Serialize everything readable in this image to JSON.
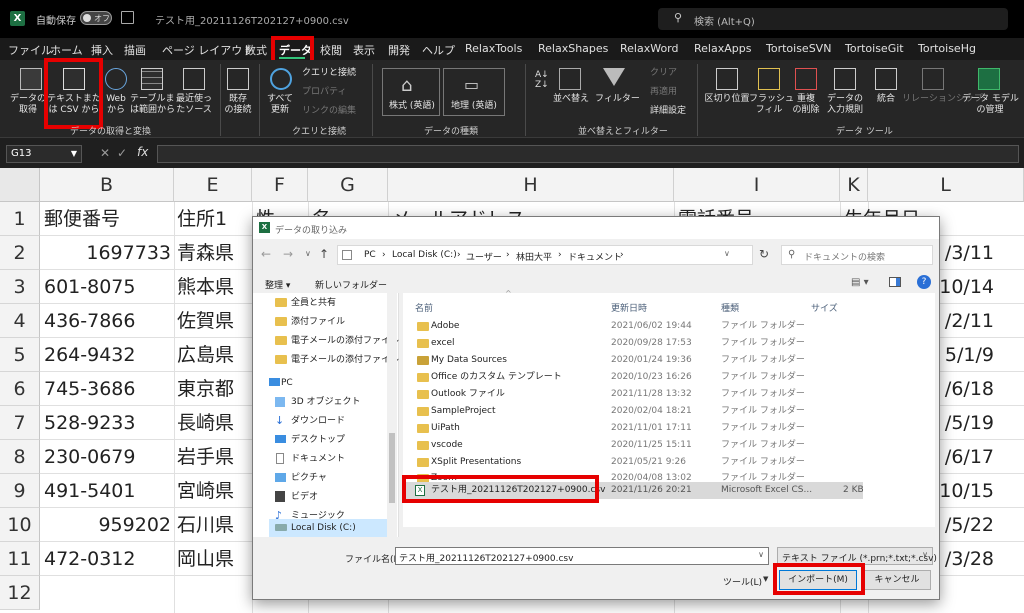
{
  "titlebar": {
    "autosave": "自動保存",
    "toggle": "オフ",
    "filename": "テスト用_20211126T202127+0900.csv",
    "search_placeholder": "検索 (Alt+Q)"
  },
  "menu": [
    "ファイル",
    "ホーム",
    "挿入",
    "描画",
    "ページ レイアウト",
    "数式",
    "データ",
    "校閲",
    "表示",
    "開発",
    "ヘルプ",
    "RelaxTools",
    "RelaxShapes",
    "RelaxWord",
    "RelaxApps",
    "TortoiseSVN",
    "TortoiseGit",
    "TortoiseHg"
  ],
  "ribbon": {
    "get_data": "データの\n取得",
    "from_csv": "テキストまた\nは CSV から",
    "from_web": "Web\nから",
    "from_table": "テーブルま\nは範囲から",
    "recent": "最近使っ\nたソース",
    "existing": "既存\nの接続",
    "refresh_all": "すべて\n更新",
    "queries": "クエリと接続",
    "properties": "プロパティ",
    "edit_links": "リンクの編集",
    "stocks": "株式 (英語)",
    "geo": "地理 (英語)",
    "sort": "並べ替え",
    "filter": "フィルター",
    "clear": "クリア",
    "reapply": "再適用",
    "advanced": "詳細設定",
    "text_to_col": "区切り位置",
    "flash_fill": "フラッシュ\nフィル",
    "remove_dup": "重複\nの削除",
    "validation": "データの\n入力規則",
    "consolidate": "統合",
    "relationships": "リレーションシップ",
    "data_model": "データ モデル\nの管理",
    "groups": [
      "データの取得と変換",
      "クエリと接続",
      "データの種類",
      "並べ替えとフィルター",
      "データ ツール"
    ]
  },
  "formula": {
    "namebox": "G13",
    "fx": "fx"
  },
  "sheet": {
    "columns": [
      "B",
      "E",
      "F",
      "G",
      "H",
      "I",
      "K",
      "L"
    ],
    "rows": [
      "1",
      "2",
      "3",
      "4",
      "5",
      "6",
      "7",
      "8",
      "9",
      "10",
      "11",
      "12"
    ],
    "colB": [
      "郵便番号",
      "1697733",
      "601-8075",
      "436-7866",
      "264-9432",
      "745-3686",
      "528-9233",
      "230-0679",
      "491-5401",
      "959202",
      "472-0312"
    ],
    "colE": [
      "住所1",
      "青森県",
      "熊本県",
      "佐賀県",
      "広島県",
      "東京都",
      "長崎県",
      "岩手県",
      "宮崎県",
      "石川県",
      "岡山県"
    ],
    "colF1": "性",
    "colG1": "名",
    "colH1": "メールアドレス",
    "colI1": "電話番号",
    "colK1": "生年月日",
    "colL": [
      "",
      "/3/11",
      "10/14",
      "/2/11",
      "5/1/9",
      "/6/18",
      "/5/19",
      "/6/17",
      "10/15",
      "/5/22",
      "/3/28"
    ]
  },
  "dialog": {
    "title": "データの取り込み",
    "path": [
      "PC",
      "Local Disk (C:)",
      "ユーザー",
      "林田大平",
      "ドキュメント"
    ],
    "search_placeholder": "ドキュメントの検索",
    "organize": "整理 ▾",
    "new_folder": "新しいフォルダー",
    "nav": [
      "全員と共有",
      "添付ファイル",
      "電子メールの添付ファイル",
      "電子メールの添付ファイル",
      "PC",
      "3D オブジェクト",
      "ダウンロード",
      "デスクトップ",
      "ドキュメント",
      "ピクチャ",
      "ビデオ",
      "ミュージック",
      "Local Disk (C:)"
    ],
    "headers": [
      "名前",
      "更新日時",
      "種類",
      "サイズ"
    ],
    "files": [
      {
        "name": "Adobe",
        "date": "2021/06/02 19:44",
        "type": "ファイル フォルダー",
        "size": ""
      },
      {
        "name": "excel",
        "date": "2020/09/28 17:53",
        "type": "ファイル フォルダー",
        "size": ""
      },
      {
        "name": "My Data Sources",
        "date": "2020/01/24 19:36",
        "type": "ファイル フォルダー",
        "size": ""
      },
      {
        "name": "Office のカスタム テンプレート",
        "date": "2020/10/23 16:26",
        "type": "ファイル フォルダー",
        "size": ""
      },
      {
        "name": "Outlook ファイル",
        "date": "2021/11/28 13:32",
        "type": "ファイル フォルダー",
        "size": ""
      },
      {
        "name": "SampleProject",
        "date": "2020/02/04 18:21",
        "type": "ファイル フォルダー",
        "size": ""
      },
      {
        "name": "UiPath",
        "date": "2021/11/01 17:11",
        "type": "ファイル フォルダー",
        "size": ""
      },
      {
        "name": "vscode",
        "date": "2020/11/25 15:11",
        "type": "ファイル フォルダー",
        "size": ""
      },
      {
        "name": "XSplit Presentations",
        "date": "2021/05/21 9:26",
        "type": "ファイル フォルダー",
        "size": ""
      },
      {
        "name": "Zoom",
        "date": "2020/04/08 13:02",
        "type": "ファイル フォルダー",
        "size": ""
      },
      {
        "name": "テスト用_20211126T202127+0900.csv",
        "date": "2021/11/26 20:21",
        "type": "Microsoft Excel CS...",
        "size": "2 KB"
      }
    ],
    "filename_label": "ファイル名(N):",
    "filename_value": "テスト用_20211126T202127+0900.csv",
    "filetype": "テキスト ファイル (*.prn;*.txt;*.csv)",
    "tools": "ツール(L)",
    "import": "インポート(M)",
    "cancel": "キャンセル"
  },
  "colors": {
    "highlight": "#e60000",
    "excel_green": "#1d6f42"
  }
}
